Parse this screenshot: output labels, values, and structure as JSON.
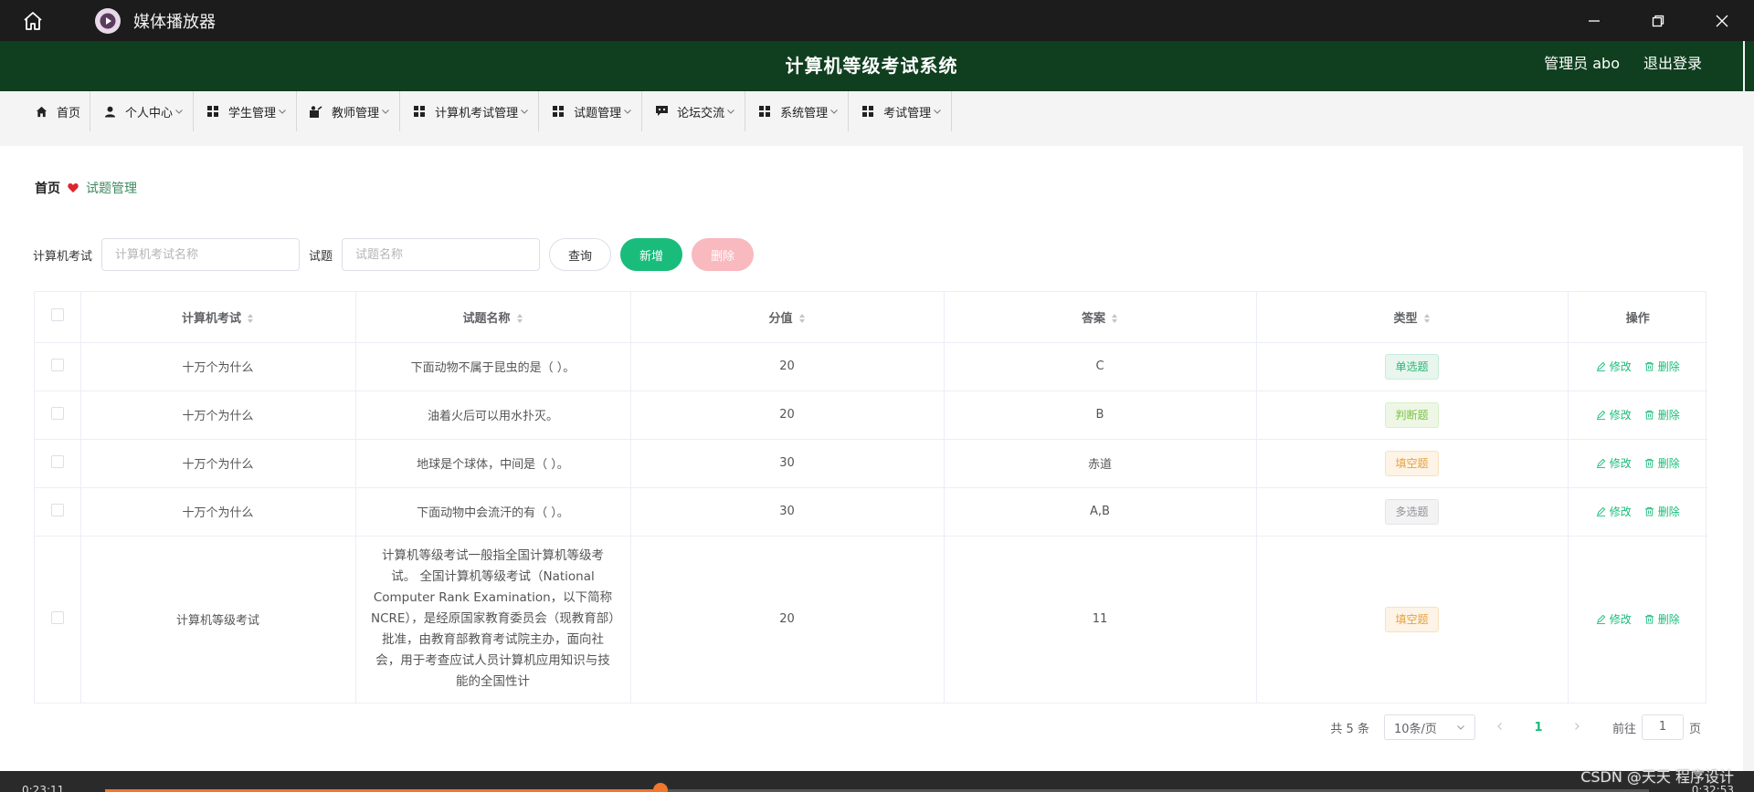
{
  "player": {
    "title": "媒体播放器",
    "time_elapsed": "0:23:11",
    "time_total": "0:32:53",
    "progress": 0.36
  },
  "app": {
    "title": "计算机等级考试系统",
    "user": "管理员 abo",
    "logout": "退出登录"
  },
  "nav": [
    {
      "label": "首页",
      "icon": "home-icon",
      "dropdown": false
    },
    {
      "label": "个人中心",
      "icon": "user-icon",
      "dropdown": true
    },
    {
      "label": "学生管理",
      "icon": "grid-icon",
      "dropdown": true
    },
    {
      "label": "教师管理",
      "icon": "teacher-icon",
      "dropdown": true
    },
    {
      "label": "计算机考试管理",
      "icon": "grid-icon",
      "dropdown": true
    },
    {
      "label": "试题管理",
      "icon": "grid-icon",
      "dropdown": true
    },
    {
      "label": "论坛交流",
      "icon": "chat-icon",
      "dropdown": true
    },
    {
      "label": "系统管理",
      "icon": "grid-icon",
      "dropdown": true
    },
    {
      "label": "考试管理",
      "icon": "grid-icon",
      "dropdown": true
    }
  ],
  "breadcrumb": {
    "home": "首页",
    "current": "试题管理"
  },
  "search": {
    "exam_label": "计算机考试",
    "exam_placeholder": "计算机考试名称",
    "question_label": "试题",
    "question_placeholder": "试题名称",
    "query": "查询",
    "add": "新增",
    "delete": "删除"
  },
  "table": {
    "headers": [
      "计算机考试",
      "试题名称",
      "分值",
      "答案",
      "类型",
      "操作"
    ],
    "rows": [
      {
        "exam": "十万个为什么",
        "question": "下面动物不属于昆虫的是（ ）。",
        "score": "20",
        "answer": "C",
        "type": "单选题",
        "type_style": "single"
      },
      {
        "exam": "十万个为什么",
        "question": "油着火后可以用水扑灭。",
        "score": "20",
        "answer": "B",
        "type": "判断题",
        "type_style": "judge"
      },
      {
        "exam": "十万个为什么",
        "question": "地球是个球体，中间是（ ）。",
        "score": "30",
        "answer": "赤道",
        "type": "填空题",
        "type_style": "fill"
      },
      {
        "exam": "十万个为什么",
        "question": "下面动物中会流汗的有（ ）。",
        "score": "30",
        "answer": "A,B",
        "type": "多选题",
        "type_style": "multi"
      },
      {
        "exam": "计算机等级考试",
        "question": "计算机等级考试一般指全国计算机等级考试。 全国计算机等级考试（National Computer Rank Examination，以下简称NCRE），是经原国家教育委员会（现教育部）批准，由教育部教育考试院主办，面向社会，用于考查应试人员计算机应用知识与技能的全国性计",
        "score": "20",
        "answer": "11",
        "type": "填空题",
        "type_style": "fill"
      }
    ],
    "edit": "修改",
    "remove": "删除"
  },
  "pagination": {
    "total": "共 5 条",
    "page_size": "10条/页",
    "current_page": "1",
    "goto_prefix": "前往",
    "goto_value": "1",
    "goto_suffix": "页"
  },
  "watermark": "CSDN @天天 程序设计",
  "colors": {
    "header_bg": "#0f3f1f",
    "accent": "#1abc7c",
    "danger_disabled": "#f8b9bf"
  }
}
